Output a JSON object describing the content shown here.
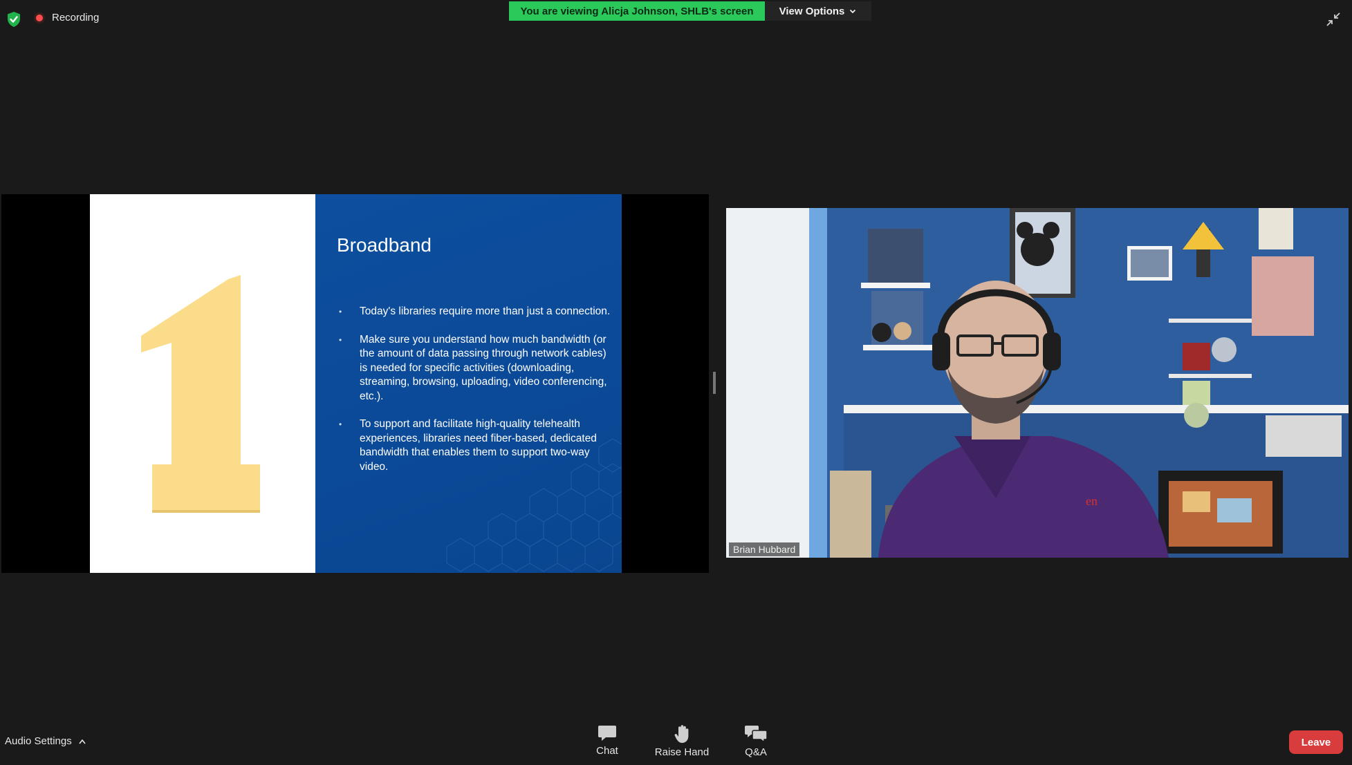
{
  "header": {
    "recording_label": "Recording",
    "viewing_banner": "You are viewing Alicja Johnson, SHLB's screen",
    "view_options_label": "View Options"
  },
  "slide": {
    "number": "1",
    "title": "Broadband",
    "bullets": [
      "Today's libraries require more than just a connection.",
      "Make sure you understand how much bandwidth (or the amount of data passing through network cables) is needed for specific activities (downloading, streaming, browsing, uploading, video conferencing, etc.).",
      "To support and facilitate high-quality telehealth experiences, libraries need fiber-based, dedicated bandwidth that enables them to support two-way video."
    ]
  },
  "speaker": {
    "name": "Brian Hubbard"
  },
  "toolbar": {
    "audio_settings_label": "Audio Settings",
    "chat_label": "Chat",
    "raise_hand_label": "Raise Hand",
    "qa_label": "Q&A",
    "leave_label": "Leave"
  },
  "icons": {
    "security": "shield-check-icon",
    "recording": "recording-dot-icon",
    "exit_fullscreen": "exit-fullscreen-icon",
    "chat": "chat-bubble-icon",
    "raise_hand": "hand-icon",
    "qa": "qa-bubbles-icon"
  },
  "colors": {
    "background": "#1a1a1a",
    "viewing_banner": "#2ac95a",
    "slide_blue": "#0b4a98",
    "slide_number": "#fadc8a",
    "leave_button": "#d93c3c"
  }
}
